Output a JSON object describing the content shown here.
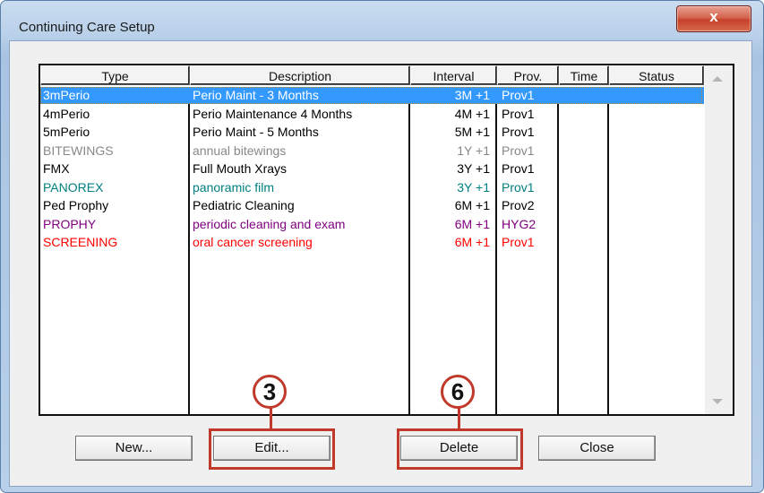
{
  "window": {
    "title": "Continuing Care Setup",
    "close_glyph": "x"
  },
  "columns": [
    "Type",
    "Description",
    "Interval",
    "Prov.",
    "Time",
    "Status"
  ],
  "rows": [
    {
      "type": "3mPerio",
      "description": "Perio Maint - 3 Months",
      "interval": "3M +1",
      "prov": "Prov1",
      "time": "",
      "status": "",
      "color": "#000000",
      "selected": true
    },
    {
      "type": "4mPerio",
      "description": "Perio Maintenance 4 Months",
      "interval": "4M +1",
      "prov": "Prov1",
      "time": "",
      "status": "",
      "color": "#000000",
      "selected": false
    },
    {
      "type": "5mPerio",
      "description": "Perio Maint - 5 Months",
      "interval": "5M +1",
      "prov": "Prov1",
      "time": "",
      "status": "",
      "color": "#000000",
      "selected": false
    },
    {
      "type": "BITEWINGS",
      "description": "annual bitewings",
      "interval": "1Y +1",
      "prov": "Prov1",
      "time": "",
      "status": "",
      "color": "#888888",
      "selected": false
    },
    {
      "type": "FMX",
      "description": "Full Mouth Xrays",
      "interval": "3Y +1",
      "prov": "Prov1",
      "time": "",
      "status": "",
      "color": "#000000",
      "selected": false
    },
    {
      "type": "PANOREX",
      "description": "panoramic film",
      "interval": "3Y +1",
      "prov": "Prov1",
      "time": "",
      "status": "",
      "color": "#008080",
      "selected": false
    },
    {
      "type": "Ped Prophy",
      "description": "Pediatric Cleaning",
      "interval": "6M +1",
      "prov": "Prov2",
      "time": "",
      "status": "",
      "color": "#000000",
      "selected": false
    },
    {
      "type": "PROPHY",
      "description": "periodic cleaning and exam",
      "interval": "6M +1",
      "prov": "HYG2",
      "time": "",
      "status": "",
      "color": "#800080",
      "selected": false
    },
    {
      "type": "SCREENING",
      "description": "oral cancer screening",
      "interval": "6M +1",
      "prov": "Prov1",
      "time": "",
      "status": "",
      "color": "#ff0000",
      "selected": false
    }
  ],
  "buttons": {
    "new": "New...",
    "edit": "Edit...",
    "delete": "Delete",
    "close": "Close"
  },
  "callouts": {
    "edit_step": "3",
    "delete_step": "6"
  }
}
